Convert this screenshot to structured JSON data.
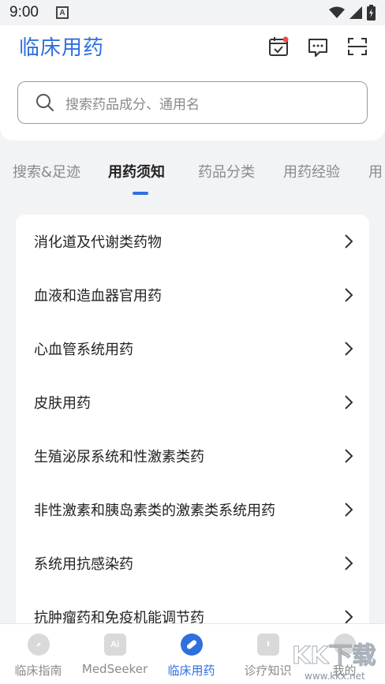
{
  "status_bar": {
    "time": "9:00",
    "notification": "A"
  },
  "header": {
    "logo": "临床用药"
  },
  "search": {
    "placeholder": "搜索药品成分、通用名"
  },
  "tabs": [
    {
      "label": "搜索&足迹"
    },
    {
      "label": "用药须知",
      "active": true
    },
    {
      "label": "药品分类"
    },
    {
      "label": "用药经验"
    },
    {
      "label": "用"
    }
  ],
  "categories": [
    {
      "label": "消化道及代谢类药物"
    },
    {
      "label": "血液和造血器官用药"
    },
    {
      "label": "心血管系统用药"
    },
    {
      "label": "皮肤用药"
    },
    {
      "label": "生殖泌尿系统和性激素类药"
    },
    {
      "label": "非性激素和胰岛素类的激素类系统用药"
    },
    {
      "label": "系统用抗感染药"
    },
    {
      "label": "抗肿瘤药和免疫机能调节药"
    }
  ],
  "bottom_nav": [
    {
      "label": "临床指南",
      "icon": "compass-icon"
    },
    {
      "label": "MedSeeker",
      "icon": "ai-icon"
    },
    {
      "label": "临床用药",
      "icon": "pill-icon",
      "active": true
    },
    {
      "label": "诊疗知识",
      "icon": "book-icon"
    },
    {
      "label": "我的",
      "icon": "user-icon"
    }
  ],
  "watermark": {
    "text": "KK下载",
    "url": "www.kkx.net"
  },
  "colors": {
    "accent": "#2f6fe0",
    "badge": "#f04a4a"
  }
}
